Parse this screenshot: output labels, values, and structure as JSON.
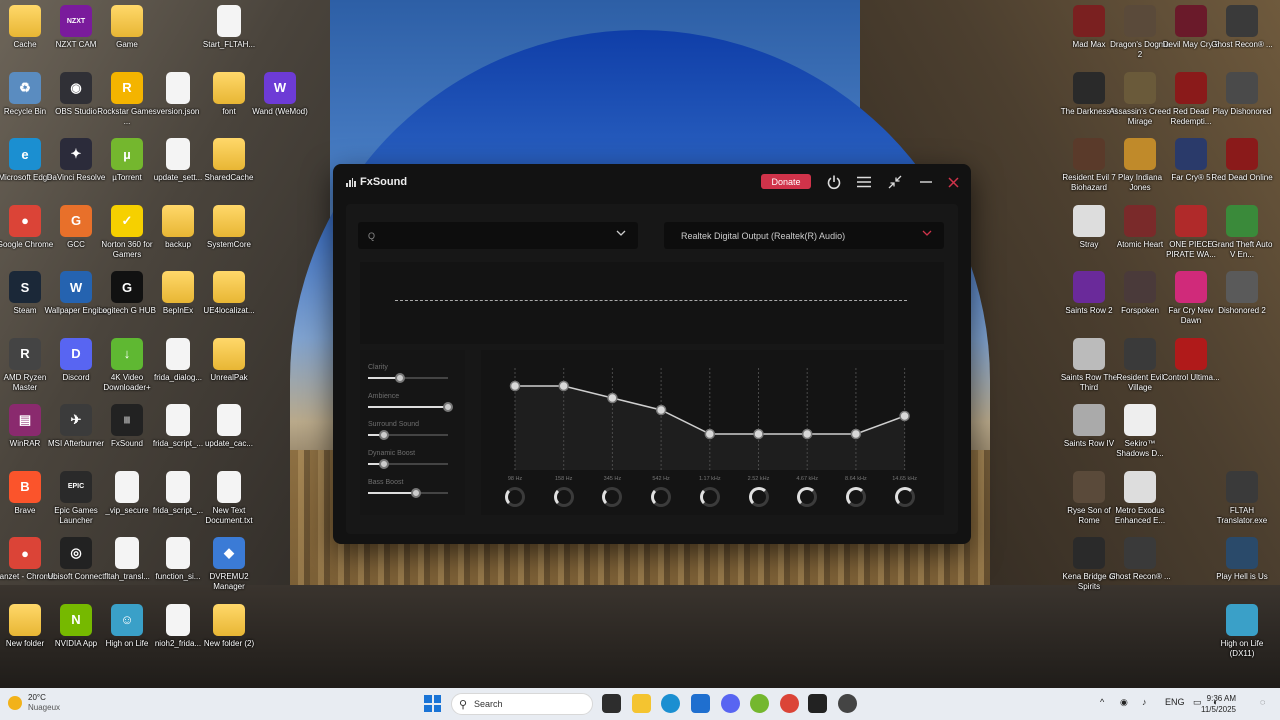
{
  "desktop": {
    "left_icons": [
      {
        "label": "Cache",
        "type": "folder",
        "col": 0,
        "row": 0
      },
      {
        "label": "NZXT CAM",
        "type": "app",
        "glyph": "NZXT",
        "color": "#7a1b9c",
        "col": 1,
        "row": 0
      },
      {
        "label": "Game",
        "type": "folder",
        "col": 2,
        "row": 0
      },
      {
        "label": "Start_FLTAH...",
        "type": "file",
        "col": 4,
        "row": 0
      },
      {
        "label": "Recycle Bin",
        "type": "app",
        "glyph": "♻",
        "color": "#5a8cc0",
        "col": 0,
        "row": 1
      },
      {
        "label": "OBS Studio",
        "type": "app",
        "glyph": "◉",
        "color": "#303036",
        "col": 1,
        "row": 1
      },
      {
        "label": "Rockstar Games ...",
        "type": "app",
        "glyph": "R",
        "color": "#f4b400",
        "col": 2,
        "row": 1
      },
      {
        "label": "version.json",
        "type": "file",
        "col": 3,
        "row": 1
      },
      {
        "label": "font",
        "type": "folder",
        "col": 4,
        "row": 1
      },
      {
        "label": "Wand (WeMod)",
        "type": "app",
        "glyph": "W",
        "color": "#6d3bd6",
        "col": 5,
        "row": 1
      },
      {
        "label": "Microsoft Edge",
        "type": "app",
        "glyph": "e",
        "color": "#1b8fd1",
        "col": 0,
        "row": 2
      },
      {
        "label": "DaVinci Resolve",
        "type": "app",
        "glyph": "✦",
        "color": "#2b2b3a",
        "col": 1,
        "row": 2
      },
      {
        "label": "µTorrent",
        "type": "app",
        "glyph": "µ",
        "color": "#74b72e",
        "col": 2,
        "row": 2
      },
      {
        "label": "update_sett...",
        "type": "file",
        "col": 3,
        "row": 2
      },
      {
        "label": "SharedCache",
        "type": "folder",
        "col": 4,
        "row": 2
      },
      {
        "label": "Google Chrome",
        "type": "app",
        "glyph": "●",
        "color": "#db4437",
        "col": 0,
        "row": 3
      },
      {
        "label": "GCC",
        "type": "app",
        "glyph": "G",
        "color": "#e8702a",
        "col": 1,
        "row": 3
      },
      {
        "label": "Norton 360 for Gamers",
        "type": "app",
        "glyph": "✓",
        "color": "#f6d000",
        "col": 2,
        "row": 3
      },
      {
        "label": "backup",
        "type": "folder",
        "col": 3,
        "row": 3
      },
      {
        "label": "SystemCore",
        "type": "folder",
        "col": 4,
        "row": 3
      },
      {
        "label": "Steam",
        "type": "app",
        "glyph": "S",
        "color": "#1b2838",
        "col": 0,
        "row": 4
      },
      {
        "label": "Wallpaper Engine",
        "type": "app",
        "glyph": "W",
        "color": "#2563b0",
        "col": 1,
        "row": 4
      },
      {
        "label": "Logitech G HUB",
        "type": "app",
        "glyph": "G",
        "color": "#111111",
        "col": 2,
        "row": 4
      },
      {
        "label": "BepInEx",
        "type": "folder",
        "col": 3,
        "row": 4
      },
      {
        "label": "UE4localizat...",
        "type": "folder",
        "col": 4,
        "row": 4
      },
      {
        "label": "AMD Ryzen Master",
        "type": "app",
        "glyph": "R",
        "color": "#444444",
        "col": 0,
        "row": 5
      },
      {
        "label": "Discord",
        "type": "app",
        "glyph": "D",
        "color": "#5865f2",
        "col": 1,
        "row": 5
      },
      {
        "label": "4K Video Downloader+",
        "type": "app",
        "glyph": "↓",
        "color": "#5fb832",
        "col": 2,
        "row": 5
      },
      {
        "label": "frida_dialog...",
        "type": "file",
        "col": 3,
        "row": 5
      },
      {
        "label": "UnrealPak",
        "type": "folder",
        "col": 4,
        "row": 5
      },
      {
        "label": "WinRAR",
        "type": "app",
        "glyph": "▤",
        "color": "#8a2a6e",
        "col": 0,
        "row": 6
      },
      {
        "label": "MSI Afterburner",
        "type": "app",
        "glyph": "✈",
        "color": "#3b3b3b",
        "col": 1,
        "row": 6
      },
      {
        "label": "FxSound",
        "type": "app",
        "glyph": "|||",
        "color": "#222222",
        "col": 2,
        "row": 6
      },
      {
        "label": "frida_script_...",
        "type": "file",
        "col": 3,
        "row": 6
      },
      {
        "label": "update_cac...",
        "type": "file",
        "col": 4,
        "row": 6
      },
      {
        "label": "Brave",
        "type": "app",
        "glyph": "B",
        "color": "#fb542b",
        "col": 0,
        "row": 7
      },
      {
        "label": "Epic Games Launcher",
        "type": "app",
        "glyph": "EPIC",
        "color": "#2a2a2a",
        "col": 1,
        "row": 7
      },
      {
        "label": "_vip_secure",
        "type": "file",
        "col": 2,
        "row": 7
      },
      {
        "label": "frida_script_...",
        "type": "file",
        "col": 3,
        "row": 7
      },
      {
        "label": "New Text Document.txt",
        "type": "file",
        "col": 4,
        "row": 7
      },
      {
        "label": "panzet - Chrome",
        "type": "app",
        "glyph": "●",
        "color": "#db4437",
        "col": 0,
        "row": 8
      },
      {
        "label": "Ubisoft Connect",
        "type": "app",
        "glyph": "◎",
        "color": "#222222",
        "col": 1,
        "row": 8
      },
      {
        "label": "fltah_transl...",
        "type": "file",
        "col": 2,
        "row": 8
      },
      {
        "label": "function_si...",
        "type": "file",
        "col": 3,
        "row": 8
      },
      {
        "label": "DVREMU2 Manager",
        "type": "app",
        "glyph": "◆",
        "color": "#3b7bd6",
        "col": 4,
        "row": 8
      },
      {
        "label": "New folder",
        "type": "folder",
        "col": 0,
        "row": 9
      },
      {
        "label": "NVIDIA App",
        "type": "app",
        "glyph": "N",
        "color": "#76b900",
        "col": 1,
        "row": 9
      },
      {
        "label": "High on Life",
        "type": "app",
        "glyph": "☺",
        "color": "#3aa0c8",
        "col": 2,
        "row": 9
      },
      {
        "label": "nioh2_frida...",
        "type": "file",
        "col": 3,
        "row": 9
      },
      {
        "label": "New folder (2)",
        "type": "folder",
        "col": 4,
        "row": 9
      }
    ],
    "right_icons": [
      {
        "label": "Mad Max",
        "color": "#7a2020",
        "col": 0,
        "row": 0
      },
      {
        "label": "Dragon's Dogma 2",
        "color": "#5a4a3a",
        "col": 1,
        "row": 0
      },
      {
        "label": "Devil May Cry 5",
        "color": "#6a1a2a",
        "col": 2,
        "row": 0
      },
      {
        "label": "Ghost Recon® ...",
        "color": "#3a3a3a",
        "col": 3,
        "row": 0
      },
      {
        "label": "The Darkness II",
        "color": "#2a2a2a",
        "col": 0,
        "row": 1
      },
      {
        "label": "Assassin's Creed Mirage",
        "color": "#6a5a3a",
        "col": 1,
        "row": 1
      },
      {
        "label": "Red Dead Redempti...",
        "color": "#8a1a1a",
        "col": 2,
        "row": 1
      },
      {
        "label": "Play Dishonored",
        "color": "#4a4a4a",
        "col": 3,
        "row": 1
      },
      {
        "label": "Resident Evil 7 Biohazard",
        "color": "#5a3a2a",
        "col": 0,
        "row": 2
      },
      {
        "label": "Play Indiana Jones",
        "color": "#c08a2a",
        "col": 1,
        "row": 2
      },
      {
        "label": "Far Cry® 5",
        "color": "#2a3a6a",
        "col": 2,
        "row": 2
      },
      {
        "label": "Red Dead Online",
        "color": "#8a1a1a",
        "col": 3,
        "row": 2
      },
      {
        "label": "Stray",
        "color": "#dddddd",
        "col": 0,
        "row": 3
      },
      {
        "label": "Atomic Heart",
        "color": "#7a2a2a",
        "col": 1,
        "row": 3
      },
      {
        "label": "ONE PIECE PIRATE WA...",
        "color": "#b02a2a",
        "col": 2,
        "row": 3
      },
      {
        "label": "Grand Theft Auto V En...",
        "color": "#3a8a3a",
        "col": 3,
        "row": 3
      },
      {
        "label": "Saints Row 2",
        "color": "#6a2a9a",
        "col": 0,
        "row": 4
      },
      {
        "label": "Forspoken",
        "color": "#4a3a3a",
        "col": 1,
        "row": 4
      },
      {
        "label": "Far Cry New Dawn",
        "color": "#d02a7a",
        "col": 2,
        "row": 4
      },
      {
        "label": "Dishonored 2",
        "color": "#5a5a5a",
        "col": 3,
        "row": 4
      },
      {
        "label": "Saints Row The Third",
        "color": "#bbbbbb",
        "col": 0,
        "row": 5
      },
      {
        "label": "Resident Evil Village",
        "color": "#3a3a3a",
        "col": 1,
        "row": 5
      },
      {
        "label": "Control Ultima...",
        "color": "#b01a1a",
        "col": 2,
        "row": 5
      },
      {
        "label": "Saints Row IV",
        "color": "#aaaaaa",
        "col": 0,
        "row": 6
      },
      {
        "label": "Sekiro™ Shadows D...",
        "color": "#eeeeee",
        "col": 1,
        "row": 6
      },
      {
        "label": "Ryse Son of Rome",
        "color": "#5a4a3a",
        "col": 0,
        "row": 7
      },
      {
        "label": "Metro Exodus Enhanced E...",
        "color": "#dddddd",
        "col": 1,
        "row": 7
      },
      {
        "label": "FLTAH Translator.exe",
        "color": "#3a3a3a",
        "col": 3,
        "row": 7
      },
      {
        "label": "Kena Bridge of Spirits",
        "color": "#2a2a2a",
        "col": 0,
        "row": 8
      },
      {
        "label": "Ghost Recon® ...",
        "color": "#3a3a3a",
        "col": 1,
        "row": 8
      },
      {
        "label": "Play Hell is Us",
        "color": "#2a4a6a",
        "col": 3,
        "row": 8
      },
      {
        "label": "High on Life (DX11)",
        "color": "#3aa0c8",
        "col": 3,
        "row": 9
      }
    ]
  },
  "fxsound": {
    "title": "FxSound",
    "donate_label": "Donate",
    "preset_value": "",
    "preset_placeholder": "Q",
    "output_device": "Realtek Digital Output (Realtek(R) Audio)",
    "effects": [
      {
        "name": "Clarity",
        "level": 0.4
      },
      {
        "name": "Ambience",
        "level": 1.0
      },
      {
        "name": "Surround Sound",
        "level": 0.2
      },
      {
        "name": "Dynamic Boost",
        "level": 0.2
      },
      {
        "name": "Bass Boost",
        "level": 0.6
      }
    ],
    "eq_bands": [
      {
        "label": "98 Hz",
        "gain": 0.5
      },
      {
        "label": "158 Hz",
        "gain": 0.5
      },
      {
        "label": "345 Hz",
        "gain": 0.3
      },
      {
        "label": "542 Hz",
        "gain": 0.1
      },
      {
        "label": "1.17 kHz",
        "gain": -0.3
      },
      {
        "label": "2.52 kHz",
        "gain": -0.3
      },
      {
        "label": "4.67 kHz",
        "gain": -0.3
      },
      {
        "label": "8.64 kHz",
        "gain": -0.3
      },
      {
        "label": "14.65 kHz",
        "gain": 0.0
      }
    ],
    "accent_color": "#d0334a"
  },
  "taskbar": {
    "weather_temp": "20°C",
    "weather_desc": "Nuageux",
    "search_placeholder": "Search",
    "language": "ENG",
    "time": "9:36 AM",
    "date": "11/5/2025"
  }
}
